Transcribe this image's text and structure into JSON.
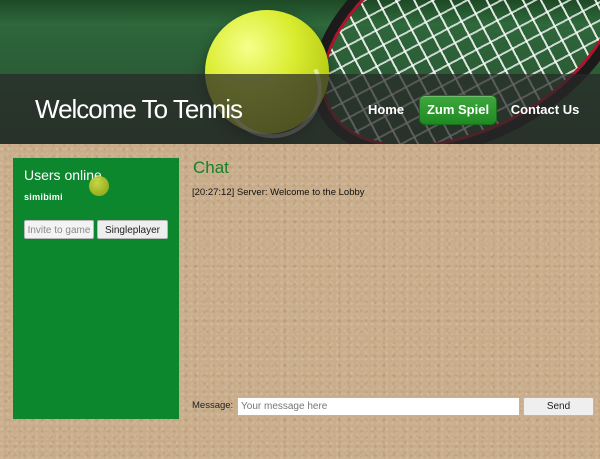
{
  "header": {
    "title": "Welcome To Tennis",
    "nav": [
      {
        "label": "Home"
      },
      {
        "label": "Zum Spiel"
      },
      {
        "label": "Contact Us"
      }
    ]
  },
  "sidebar": {
    "heading": "Users online",
    "users": [
      "simibimi"
    ],
    "invite_label": "Invite to game",
    "singleplayer_label": "Singleplayer"
  },
  "chat": {
    "heading": "Chat",
    "messages": [
      "[20:27:12] Server: Welcome to the Lobby"
    ],
    "message_label": "Message:",
    "input_placeholder": "Your message here",
    "input_value": "",
    "send_label": "Send"
  },
  "colors": {
    "accent_green": "#0c872e",
    "button_green": "#2a9a2c",
    "background_sand": "#c9ad8a"
  },
  "icons": [
    "tennis-ball-icon"
  ]
}
